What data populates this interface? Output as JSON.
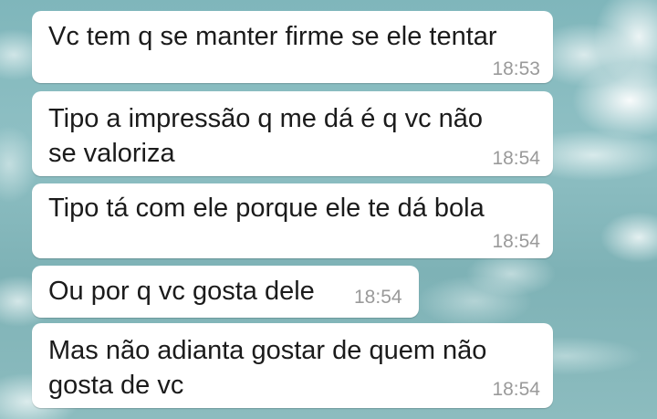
{
  "messages": [
    {
      "text": "Vc tem q se manter firme se ele tentar",
      "time": "18:53"
    },
    {
      "text": "Tipo a impressão q me dá é q vc não\nse valoriza",
      "time": "18:54"
    },
    {
      "text": "Tipo tá com ele porque ele te dá bola",
      "time": "18:54"
    },
    {
      "text": "Ou por q vc gosta dele",
      "time": "18:54"
    },
    {
      "text": "Mas não adianta gostar de quem não\ngosta de vc",
      "time": "18:54"
    }
  ],
  "colors": {
    "bubble": "#ffffff",
    "text": "#1b1b1b",
    "timestamp": "#9a9a9a",
    "wallpaper": "#7fb6bb"
  }
}
